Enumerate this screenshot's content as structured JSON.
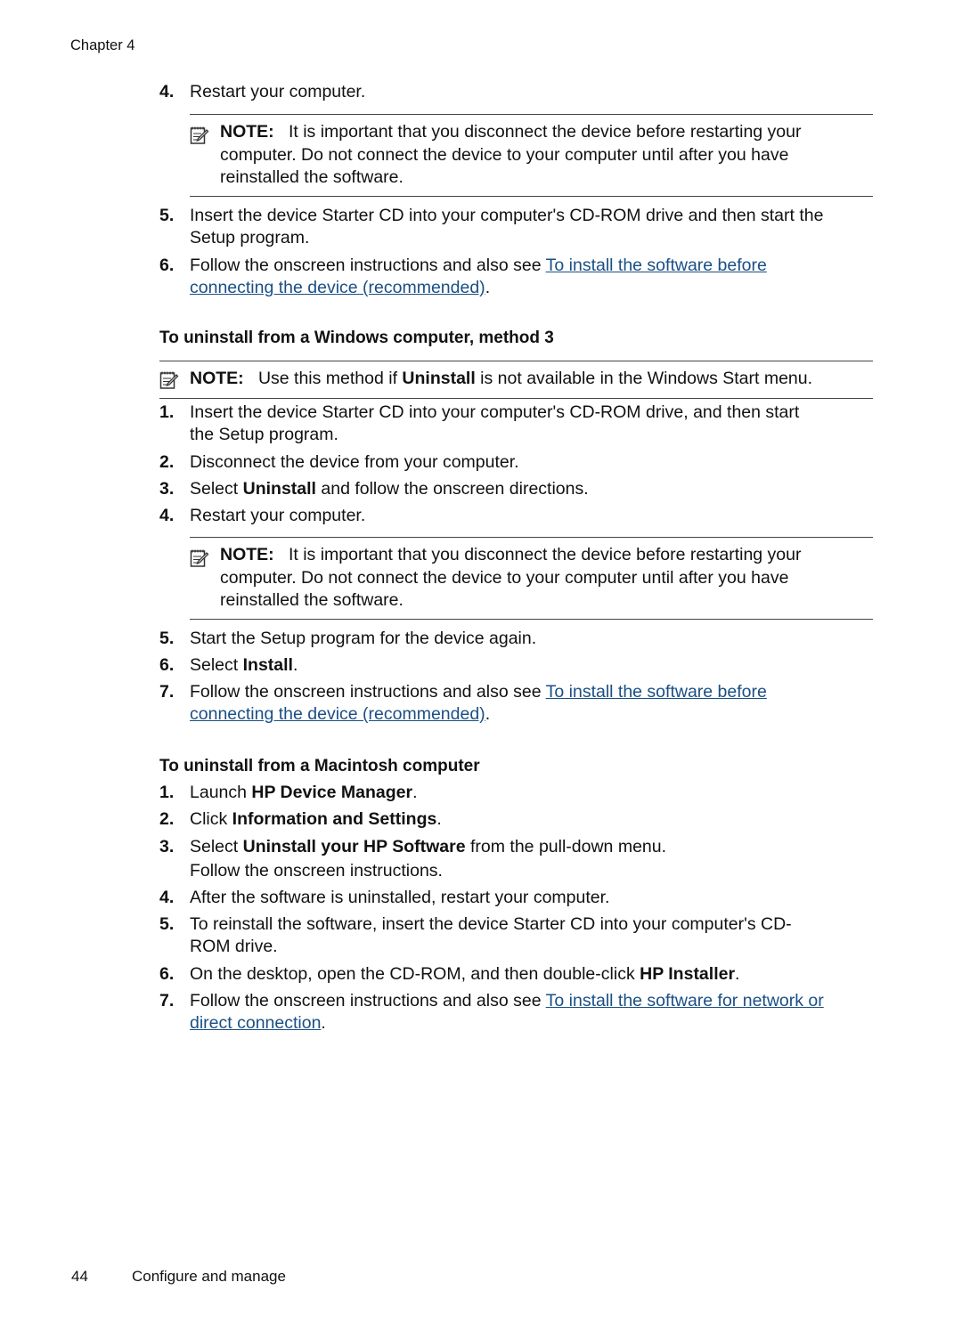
{
  "header": {
    "chapter": "Chapter 4"
  },
  "footer": {
    "page_number": "44",
    "section": "Configure and manage"
  },
  "colors": {
    "link": "#1a4f85",
    "text": "#111111",
    "rule": "#444444"
  },
  "block1": {
    "step4": {
      "num": "4.",
      "text": "Restart your computer."
    },
    "note": {
      "label": "NOTE:",
      "line1": "It is important that you disconnect the device before restarting your",
      "line2": "computer. Do not connect the device to your computer until after you have",
      "line3": "reinstalled the software."
    },
    "step5": {
      "num": "5.",
      "line1": "Insert the device Starter CD into your computer's CD-ROM drive and then start the",
      "line2": "Setup program."
    },
    "step6": {
      "num": "6.",
      "pre": "Follow the onscreen instructions and also see ",
      "link1": "To install the software before",
      "link2": "connecting the device (recommended)",
      "post": "."
    }
  },
  "method3": {
    "heading": "To uninstall from a Windows computer, method 3",
    "note": {
      "label": "NOTE:",
      "pre": "Use this method if ",
      "bold": "Uninstall",
      "post": " is not available in the Windows Start menu."
    },
    "steps": [
      {
        "num": "1.",
        "line1": "Insert the device Starter CD into your computer's CD-ROM drive, and then start",
        "line2": "the Setup program."
      },
      {
        "num": "2.",
        "text": "Disconnect the device from your computer."
      },
      {
        "num": "3.",
        "pre": "Select ",
        "bold": "Uninstall",
        "post": " and follow the onscreen directions."
      },
      {
        "num": "4.",
        "text": "Restart your computer."
      }
    ],
    "note2": {
      "label": "NOTE:",
      "line1": "It is important that you disconnect the device before restarting your",
      "line2": "computer. Do not connect the device to your computer until after you have",
      "line3": "reinstalled the software."
    },
    "steps2": [
      {
        "num": "5.",
        "text": "Start the Setup program for the device again."
      },
      {
        "num": "6.",
        "pre": "Select ",
        "bold": "Install",
        "post": "."
      },
      {
        "num": "7.",
        "pre": "Follow the onscreen instructions and also see ",
        "link1": "To install the software before",
        "link2": "connecting the device (recommended)",
        "post": "."
      }
    ]
  },
  "mac": {
    "heading": "To uninstall from a Macintosh computer",
    "steps": [
      {
        "num": "1.",
        "pre": "Launch ",
        "bold": "HP Device Manager",
        "post": "."
      },
      {
        "num": "2.",
        "pre": "Click ",
        "bold": "Information and Settings",
        "post": "."
      },
      {
        "num": "3.",
        "pre": "Select ",
        "bold": "Uninstall your HP Software",
        "post": " from the pull-down menu.",
        "line2": "Follow the onscreen instructions."
      },
      {
        "num": "4.",
        "text": "After the software is uninstalled, restart your computer."
      },
      {
        "num": "5.",
        "line1": "To reinstall the software, insert the device Starter CD into your computer's CD-",
        "line2": "ROM drive."
      },
      {
        "num": "6.",
        "pre": "On the desktop, open the CD-ROM, and then double-click ",
        "bold": "HP Installer",
        "post": "."
      },
      {
        "num": "7.",
        "pre": "Follow the onscreen instructions and also see ",
        "link1": "To install the software for network or",
        "link2": "direct connection",
        "post": "."
      }
    ]
  }
}
